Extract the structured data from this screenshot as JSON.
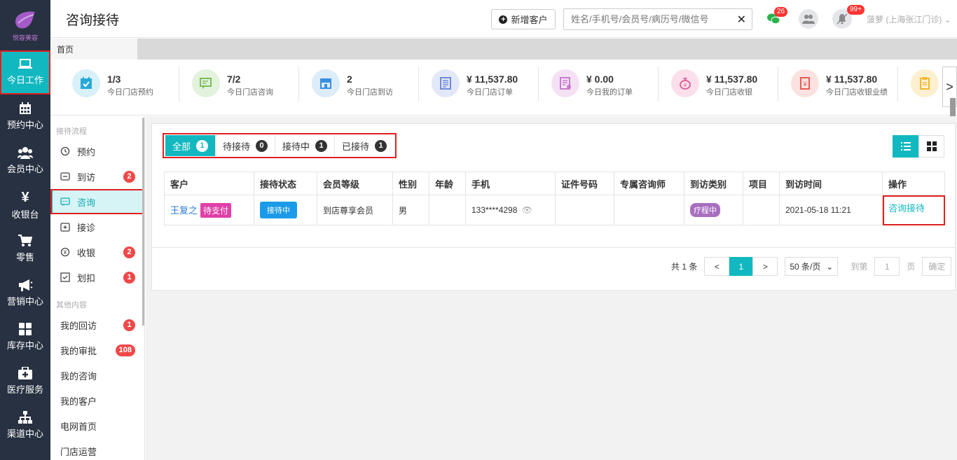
{
  "app": {
    "logo_text": "悦容美容",
    "page_title": "咨询接待"
  },
  "leftnav": [
    {
      "label": "今日工作",
      "icon": "laptop-icon",
      "active": true
    },
    {
      "label": "预约中心",
      "icon": "calendar-icon"
    },
    {
      "label": "会员中心",
      "icon": "users-icon"
    },
    {
      "label": "收银台",
      "icon": "yen-icon"
    },
    {
      "label": "零售",
      "icon": "cart-icon"
    },
    {
      "label": "营销中心",
      "icon": "megaphone-icon"
    },
    {
      "label": "库存中心",
      "icon": "grid-icon"
    },
    {
      "label": "医疗服务",
      "icon": "medkit-icon"
    },
    {
      "label": "渠道中心",
      "icon": "sitemap-icon"
    }
  ],
  "topbar": {
    "add_customer": "新增客户",
    "search_placeholder": "姓名/手机号/会员号/病历号/微信号",
    "wechat_badge": "26",
    "notify_badge": "99+",
    "user": "菠萝 (上海张江门诊)"
  },
  "tabs": {
    "home": "首页"
  },
  "stats": [
    {
      "value": "1/3",
      "label": "今日门店预约",
      "color": "#d8f0f8",
      "icon_color": "#2aa8d8"
    },
    {
      "value": "7/2",
      "label": "今日门店咨询",
      "color": "#e2f2dc",
      "icon_color": "#7cbd5c"
    },
    {
      "value": "2",
      "label": "今日门店到访",
      "color": "#dcecf8",
      "icon_color": "#3a8ee0"
    },
    {
      "value": "¥ 11,537.80",
      "label": "今日门店订单",
      "color": "#e2e8f8",
      "icon_color": "#6f8ad8"
    },
    {
      "value": "¥ 0.00",
      "label": "今日我的订单",
      "color": "#f4e2f4",
      "icon_color": "#c87ad0"
    },
    {
      "value": "¥ 11,537.80",
      "label": "今日门店收银",
      "color": "#fbe0ec",
      "icon_color": "#e0609a"
    },
    {
      "value": "¥ 11,537.80",
      "label": "今日门店收银业绩",
      "color": "#fbe2e0",
      "icon_color": "#e85a50"
    },
    {
      "value": "",
      "label": "",
      "color": "#fdf0d0",
      "icon_color": "#f0b830"
    }
  ],
  "sidemenu": {
    "group1": "接待流程",
    "items1": [
      {
        "label": "预约",
        "count": ""
      },
      {
        "label": "到访",
        "count": "2"
      },
      {
        "label": "咨询",
        "count": "",
        "active": true
      },
      {
        "label": "接诊",
        "count": ""
      },
      {
        "label": "收银",
        "count": "2"
      },
      {
        "label": "划扣",
        "count": "1"
      }
    ],
    "group2": "其他内容",
    "items2": [
      {
        "label": "我的回访",
        "count": "1"
      },
      {
        "label": "我的审批",
        "count": "108"
      },
      {
        "label": "我的咨询",
        "count": ""
      },
      {
        "label": "我的客户",
        "count": ""
      },
      {
        "label": "电网首页",
        "count": ""
      },
      {
        "label": "门店运营",
        "count": ""
      }
    ]
  },
  "filter_tabs": [
    {
      "label": "全部",
      "count": "1",
      "active": true
    },
    {
      "label": "待接待",
      "count": "0"
    },
    {
      "label": "接待中",
      "count": "1"
    },
    {
      "label": "已接待",
      "count": "1"
    }
  ],
  "table": {
    "headers": [
      "客户",
      "接待状态",
      "会员等级",
      "性别",
      "年龄",
      "手机",
      "证件号码",
      "专属咨询师",
      "到访类别",
      "项目",
      "到访时间",
      "操作"
    ],
    "rows": [
      {
        "customer": "王复之",
        "customer_tag": "待支付",
        "status": "接待中",
        "level": "到店尊享会员",
        "gender": "男",
        "age": "",
        "phone": "133****4298",
        "id_no": "",
        "consultant": "",
        "visit_type": "疗程中",
        "project": "",
        "visit_time": "2021-05-18 11:21",
        "action": "咨询接待"
      }
    ]
  },
  "pager": {
    "total": "共 1 条",
    "prev": "<",
    "current": "1",
    "next": ">",
    "per_page": "50 条/页",
    "goto_label": "到第",
    "goto_value": "1",
    "page_suffix": "页",
    "confirm": "确定"
  }
}
